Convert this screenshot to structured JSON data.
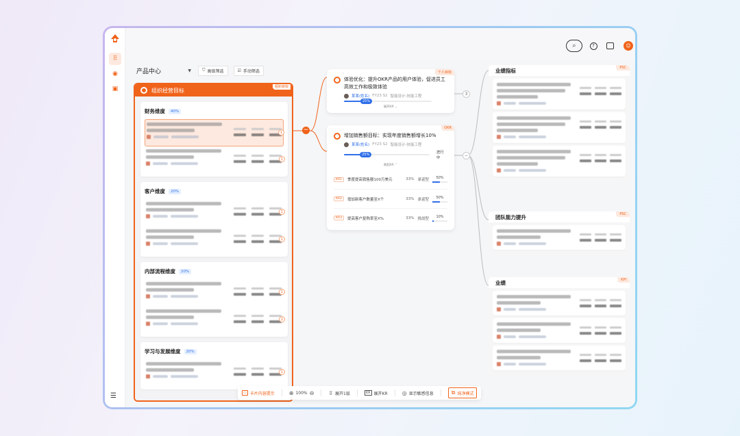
{
  "selector": {
    "value": "产品中心"
  },
  "filters": {
    "advanced": "高级筛选",
    "manual": "手动筛选"
  },
  "org": {
    "title": "组织经营目标",
    "tag": "组织目标",
    "sections": [
      {
        "title": "财务维度",
        "weight": "40%",
        "rows": [
          {
            "highlight": true,
            "n": "1"
          },
          {
            "highlight": false,
            "n": "1"
          }
        ]
      },
      {
        "title": "客户维度",
        "weight": "20%",
        "rows": [
          {
            "highlight": false,
            "n": "1"
          },
          {
            "highlight": false,
            "n": "1"
          }
        ]
      },
      {
        "title": "内部流程维度",
        "weight": "20%",
        "rows": [
          {
            "highlight": false,
            "n": "1"
          },
          {
            "highlight": false,
            "n": "2"
          }
        ]
      },
      {
        "title": "学习与发展维度",
        "weight": "20%",
        "rows": [
          {
            "highlight": false,
            "n": "1"
          }
        ]
      }
    ]
  },
  "card1": {
    "tag": "个人目标",
    "title": "体验优化：提升OKR产品的用户体验，促进员工高效工作和极致体验",
    "owner": "某某(姓名)",
    "period": "FY23 S2",
    "dept": "智能设计-技能工程",
    "progress": 25,
    "progress_label": "25%",
    "expand": "展开KR",
    "child_count": "3"
  },
  "card2": {
    "tag": "OKR",
    "title": "增加销售额目标：实现年度销售额增长10%",
    "owner": "某某(姓名)",
    "period": "FY23 S2",
    "dept": "智能设计-技能工程",
    "progress": 25,
    "progress_label": "25%",
    "status": "进行中",
    "collapse": "收起KR",
    "krs": [
      {
        "tag": "KR1",
        "name": "季度提高销售额100万美元",
        "weight": "33%",
        "type": "承诺型",
        "progress": 50,
        "progress_label": "50%"
      },
      {
        "tag": "KR2",
        "name": "增加新客户数量至X个",
        "weight": "33%",
        "type": "承诺型",
        "progress": 50,
        "progress_label": "50%"
      },
      {
        "tag": "KR3",
        "name": "提高客户复购率至X%",
        "weight": "33%",
        "type": "挑战型",
        "progress": 10,
        "progress_label": "10%"
      }
    ]
  },
  "right": [
    {
      "title": "业绩指标",
      "tag": "PSC",
      "items": 3
    },
    {
      "title": "团队能力提升",
      "tag": "PSC",
      "items": 1
    },
    {
      "title": "业绩",
      "tag": "KPI",
      "items": 3
    }
  ],
  "toolbar": {
    "card_hint": "卡片内容提示",
    "zoom": "100%",
    "expand_level": "展开1层",
    "expand_kr": "展开KR",
    "show_sensitive": "显示敏感信息",
    "pure_mode": "纯净模式"
  },
  "colors": {
    "accent": "#f0631a",
    "blue": "#2f6fe8"
  }
}
